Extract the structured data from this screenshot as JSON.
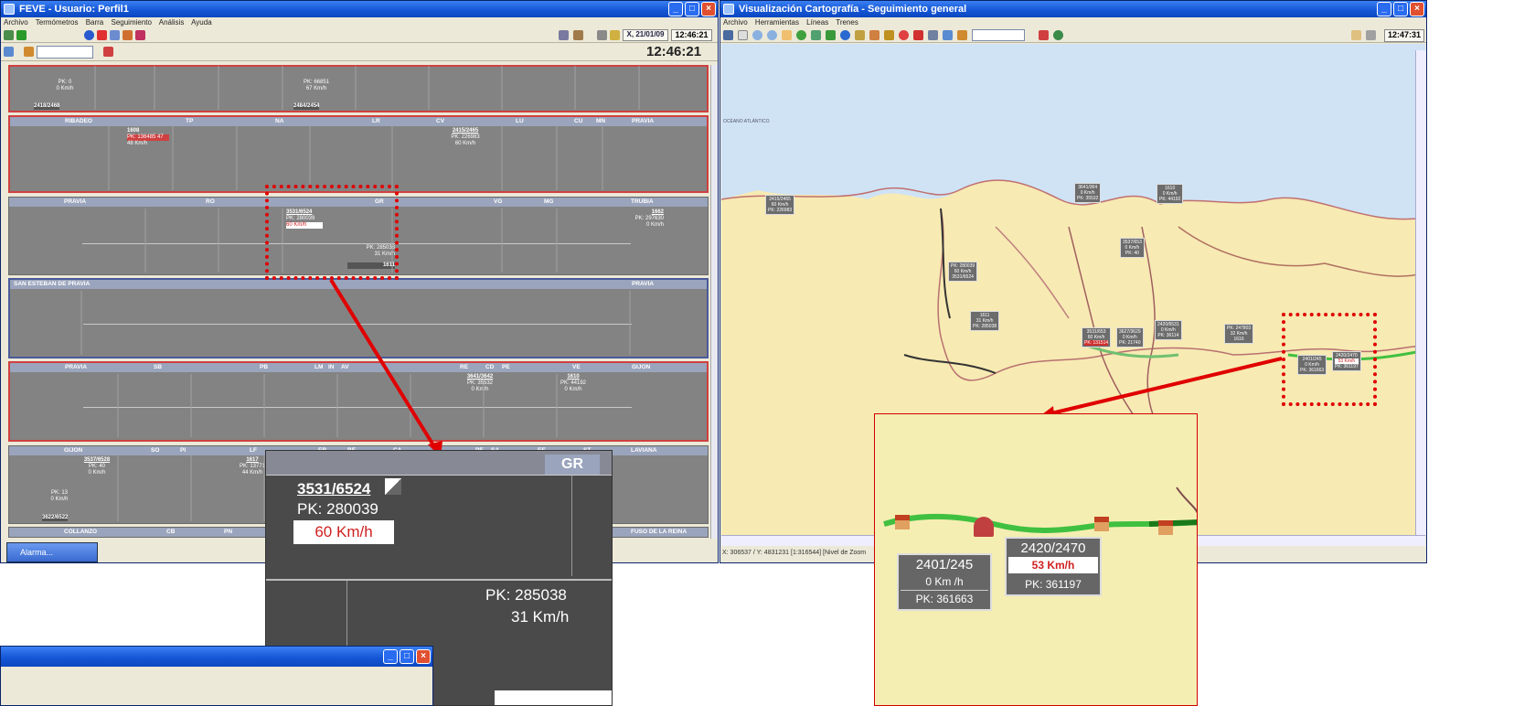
{
  "left_window": {
    "title": "FEVE - Usuario: Perfil1",
    "menu": [
      "Archivo",
      "Termómetros",
      "Barra",
      "Seguimiento",
      "Análisis",
      "Ayuda"
    ],
    "date": "X, 21/01/09",
    "time": "12:46:21",
    "big_clock": "12:46:21",
    "p1": {
      "t1": "PK: 0",
      "t2": "0 Km/h",
      "t3": "PK: 66851",
      "t4": "67 Km/h",
      "id1": "2418/2468",
      "id2": "2484/2454"
    },
    "p2": {
      "stations": [
        "RIBADEO",
        "TP",
        "NA",
        "LR",
        "CV",
        "LU",
        "CU",
        "MN",
        "PRAVIA"
      ],
      "tr1": "1608",
      "tr1pk": "PK: 136485",
      "tr1x": "47",
      "tr1s": "48 Km/h",
      "tr2": "2415/2465",
      "tr2pk": "PK: 226983",
      "tr2s": "60 Km/h"
    },
    "p3": {
      "stations": [
        "PRAVIA",
        "RO",
        "GR",
        "VG",
        "MG",
        "TRUBIA"
      ],
      "tr1": "3531/6524",
      "tr1pk": "PK: 280039",
      "tr1s": "60 Km/h",
      "tr2pk": "PK: 285038",
      "tr2s": "31 Km/h",
      "tr2id": "1611",
      "tr3": "1662",
      "tr3pk": "PK: 297630",
      "tr3s": "0 Km/h"
    },
    "p4": {
      "left": "SAN ESTEBAN DE PRAVIA",
      "right": "PRAVIA"
    },
    "p5": {
      "stations": [
        "PRAVIA",
        "SB",
        "PB",
        "LM",
        "IN",
        "AV",
        "RE",
        "CD",
        "PE",
        "VE",
        "GIJON"
      ],
      "tr1": "3641/3642",
      "tr1pk": "PK: 35532",
      "tr1s": "0 Km/h",
      "tr2": "1610",
      "tr2pk": "PK: 44192",
      "tr2s": "0 Km/h"
    },
    "p6": {
      "stations": [
        "GIJON",
        "SO",
        "PI",
        "LF",
        "ER",
        "BE",
        "CA",
        "PE",
        "SA",
        "EE",
        "ST",
        "LAVIANA"
      ],
      "tr1": "3537/6528",
      "tr1pk": "PK: 40",
      "tr1s": "0 Km/h",
      "tr2": "1617",
      "tr2pk": "PK: 13771",
      "tr2s": "44 Km/h",
      "tr3pk": "PK: 13",
      "tr3s": "0 Km/h",
      "tr3id": "3622/6522"
    },
    "p7": {
      "stations": [
        "COLLANZO",
        "CB",
        "PN",
        "FUSO DE LA REINA"
      ]
    },
    "taskbar": "Alarma..."
  },
  "zoom_left": {
    "header": "GR",
    "id": "3531/6524",
    "pk": "PK: 280039",
    "speed": "60 Km/h",
    "pk2": "PK: 285038",
    "speed2": "31 Km/h"
  },
  "right_window": {
    "title": "Visualización Cartografía - Seguimiento general",
    "menu": [
      "Archivo",
      "Herramientas",
      "Líneas",
      "Trenes"
    ],
    "time": "12:47:31",
    "ocean": "OCÉANO ATLÁNTICO",
    "labels": [
      {
        "l1": "2415/2465",
        "l2": "60 Km/h",
        "l3": "PK: 226983"
      },
      {
        "l1": "3641/364",
        "l2": "0 Km/h",
        "l3": "PK: 35532"
      },
      {
        "l1": "1610",
        "l2": "0 Km/h",
        "l3": "PK: 44192"
      },
      {
        "l1": "3537/653",
        "l2": "0 Km/h",
        "l3": "PK: 40"
      },
      {
        "l1": "PK: 280039",
        "l2": "60 Km/h",
        "l3": "3531/6524"
      },
      {
        "l1": "1611",
        "l2": "31 Km/h",
        "l3": "PK: 285038"
      },
      {
        "l1": "3531/653",
        "l2": "60 Km/h",
        "l3": "PK: 131514"
      },
      {
        "l1": "3627/3629",
        "l2": "0 Km/h",
        "l3": "PK: 21740"
      },
      {
        "l1": "2420/6531",
        "l2": "0 Km/h",
        "l3": "PK: 36114"
      },
      {
        "l1": "PK: 247803",
        "l2": "32 Km/h",
        "l3": "1616"
      },
      {
        "l1": "2401/245",
        "l2": "0 Km/h",
        "l3": "PK: 361663"
      },
      {
        "l1": "2420/2470",
        "l2": "53 Km/h",
        "l3": "PK: 361197"
      }
    ],
    "status": "X: 306537 / Y: 4831231   [1:316544]   [Nivel de Zoom"
  },
  "zoom_right": {
    "a1": "2401/245",
    "a2": "0 Km /h",
    "a3": "PK: 361663",
    "b1": "2420/2470",
    "b2": "53 Km/h",
    "b3": "PK: 361197"
  },
  "bottom_window": {
    "title": ""
  }
}
